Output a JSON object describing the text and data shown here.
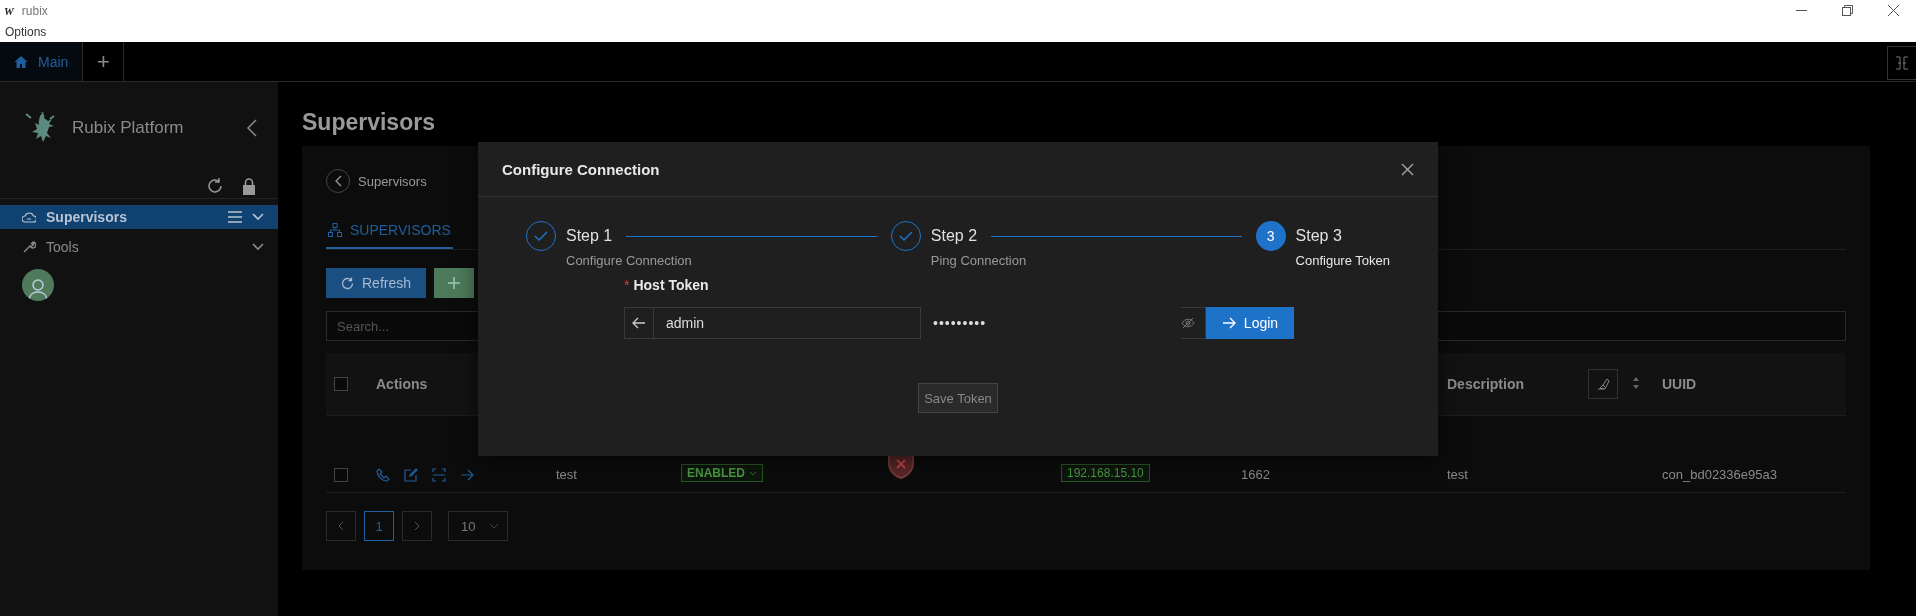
{
  "window": {
    "logo": "W",
    "title": "rubix",
    "menu": [
      "Options"
    ]
  },
  "app_tabs": [
    {
      "label": "Main",
      "selected": true,
      "kind": "home"
    },
    {
      "label": "+",
      "selected": false,
      "kind": "add"
    }
  ],
  "sidebar": {
    "brand": "Rubix Platform",
    "items": [
      {
        "label": "Supervisors",
        "selected": true
      },
      {
        "label": "Tools",
        "selected": false
      }
    ]
  },
  "page": {
    "title": "Supervisors",
    "breadcrumb": "Supervisors",
    "tabs": [
      {
        "label": "SUPERVISORS",
        "selected": true
      }
    ],
    "refresh_button": "Refresh",
    "search": {
      "placeholder": "Search..."
    },
    "table": {
      "all_selected": false,
      "columns": [
        "Actions",
        "Description",
        "UUID"
      ],
      "rows": [
        {
          "selected": false,
          "name": "test",
          "status": "ENABLED",
          "address": "192.168.15.10",
          "port": "1662",
          "description": "test",
          "uuid": "con_bd02336e95a3"
        }
      ]
    },
    "pagination": {
      "pages": [
        {
          "label": "1",
          "selected": true
        }
      ],
      "page_size": "10"
    }
  },
  "modal": {
    "title": "Configure Connection",
    "steps": [
      {
        "title": "Step 1",
        "description": "Configure Connection",
        "kind": "done"
      },
      {
        "title": "Step 2",
        "description": "Ping Connection",
        "kind": "done"
      },
      {
        "title": "Step 3",
        "description": "Configure Token",
        "kind": "current",
        "number": "3"
      }
    ],
    "field_label": "Host Token",
    "required_mark": "*",
    "username": "admin",
    "password": "•••••••••",
    "login_button": "Login",
    "save_button": {
      "label": "Save Token",
      "disabled": true
    }
  }
}
